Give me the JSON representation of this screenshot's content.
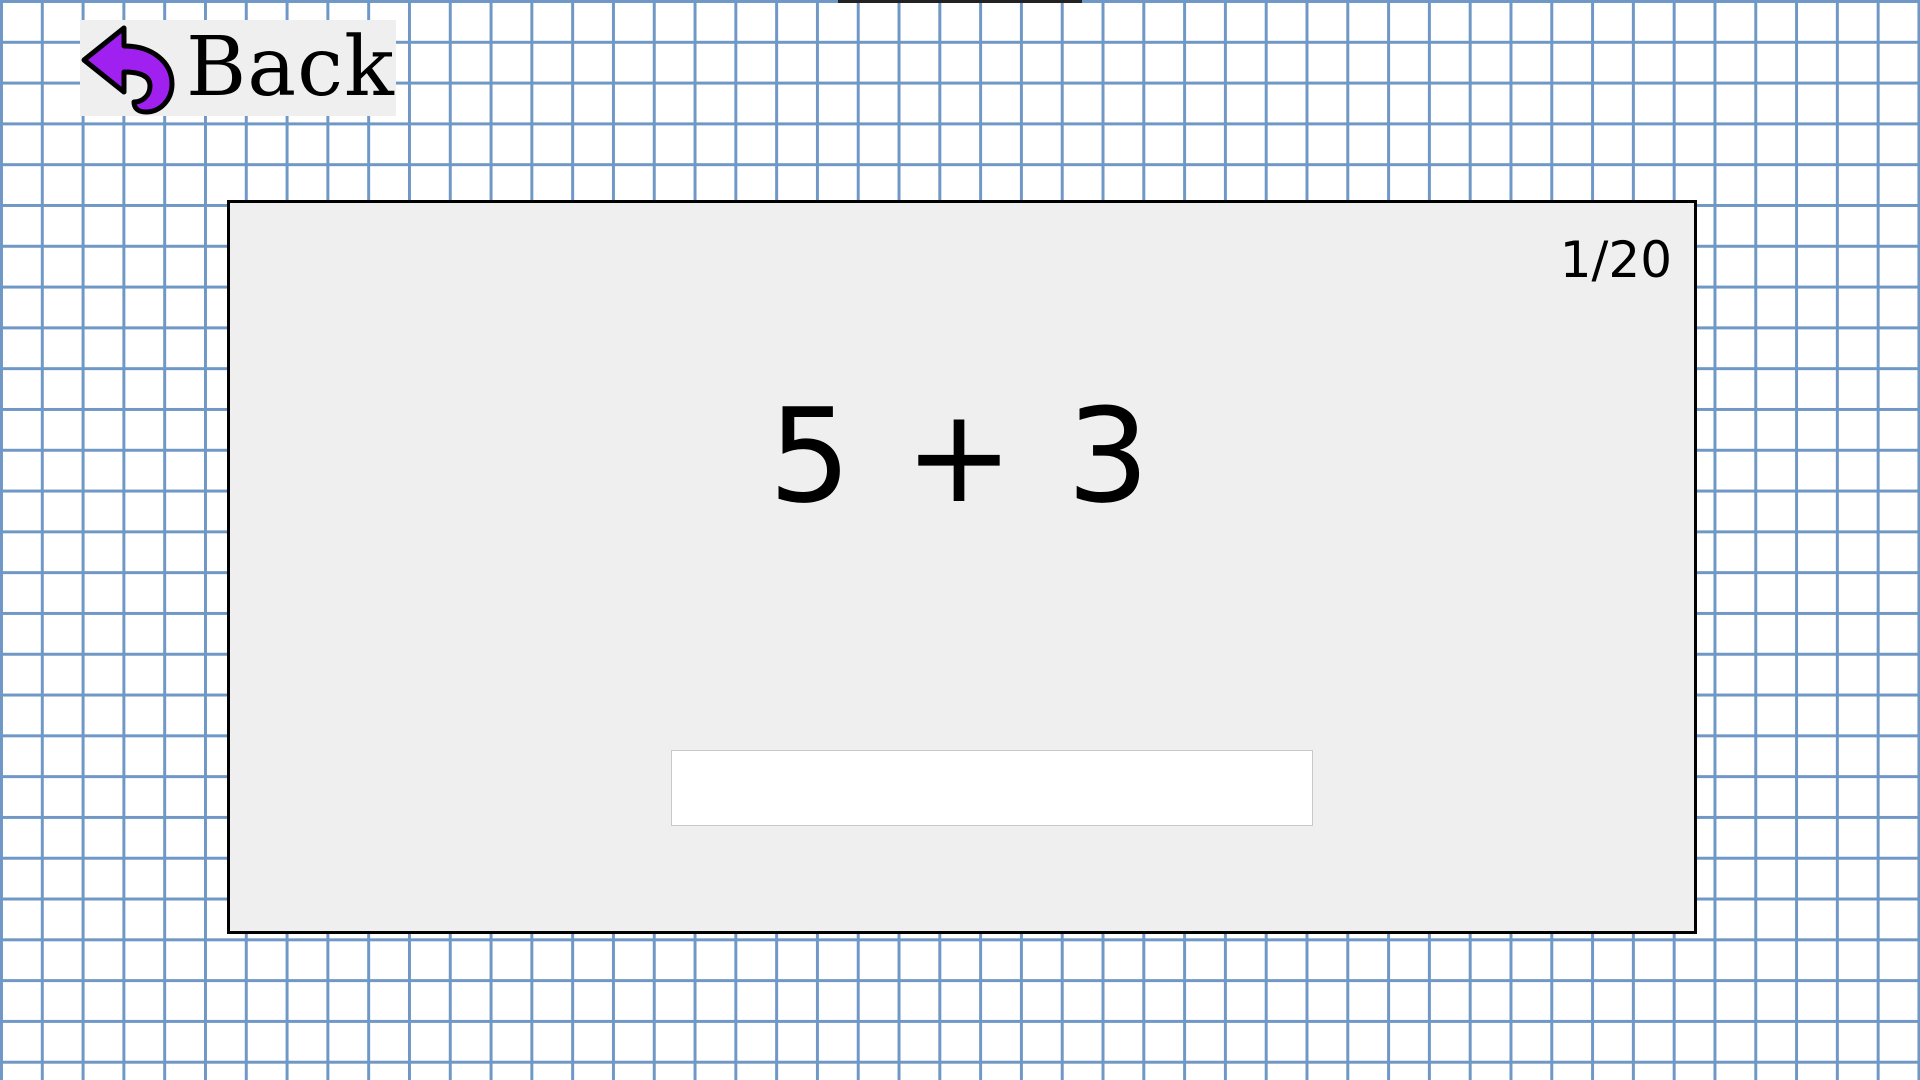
{
  "back_button": {
    "label": "Back",
    "icon": "back-arrow-icon",
    "icon_color": "#a020f0"
  },
  "quiz": {
    "progress": "1/20",
    "problem": "5 + 3",
    "answer_value": ""
  },
  "colors": {
    "grid_line": "#6f98c6",
    "card_background": "#efefef",
    "card_border": "#000000"
  }
}
